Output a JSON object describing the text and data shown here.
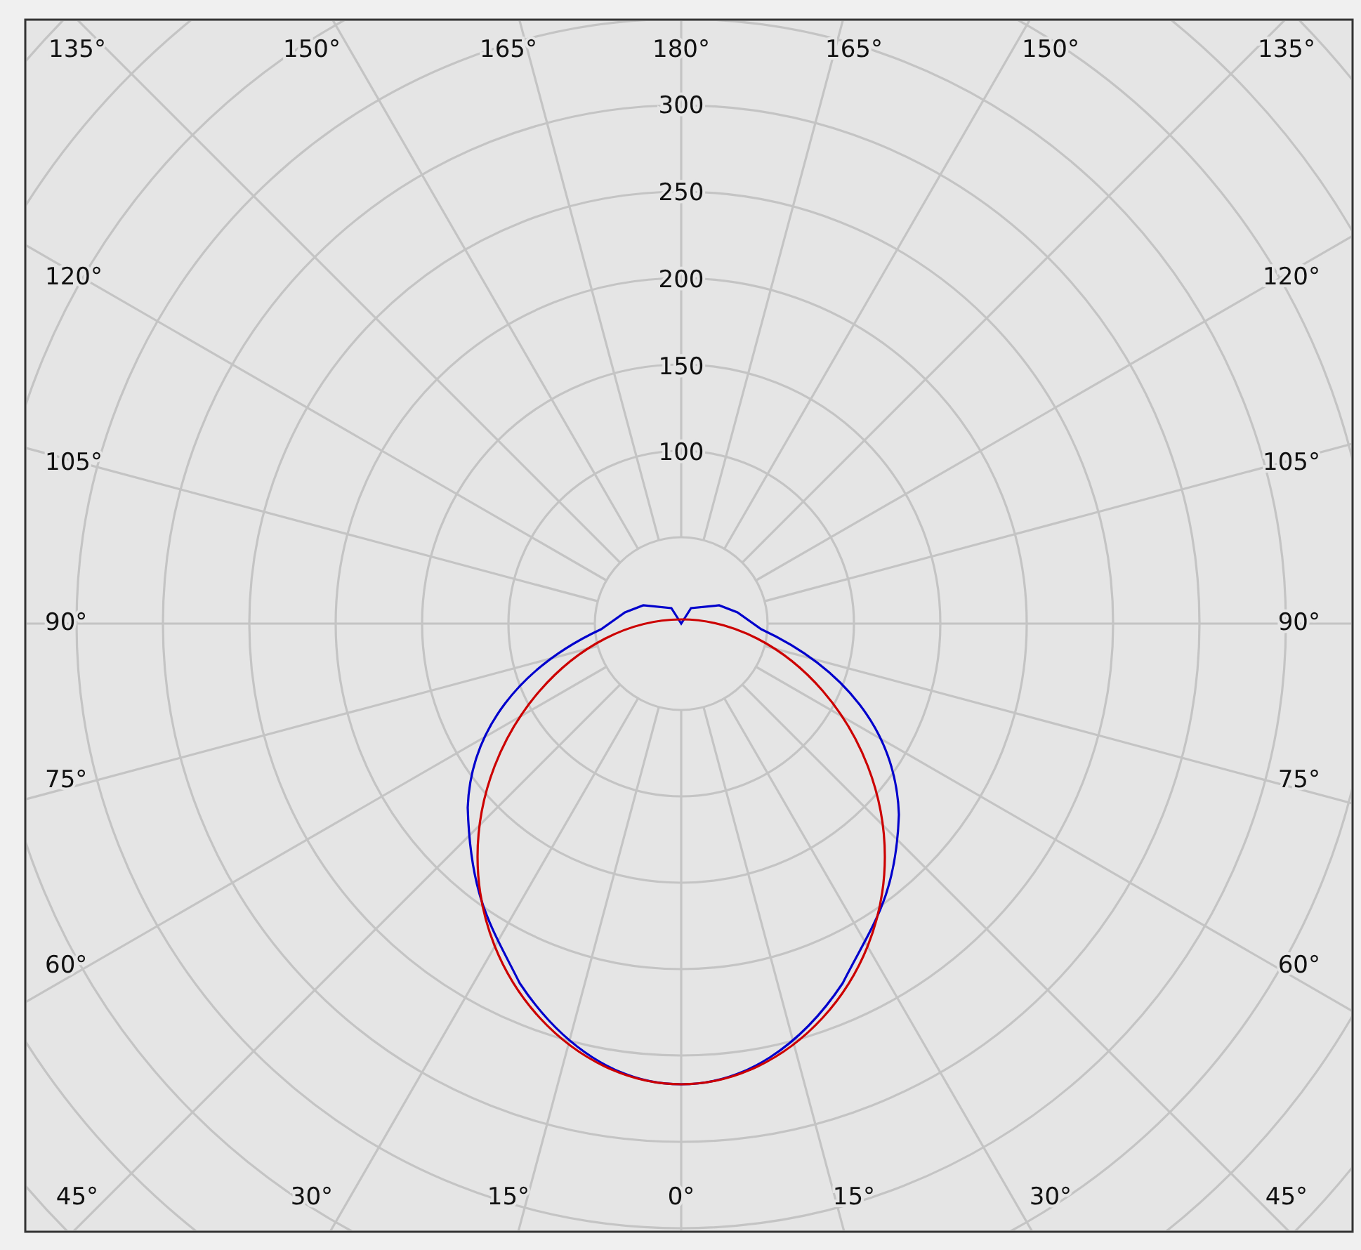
{
  "chart": {
    "top_labels": [
      "135°",
      "150°",
      "165°",
      "180°",
      "165°",
      "150°",
      "135°"
    ],
    "left_labels": [
      "120°",
      "105°",
      "90°",
      "75°",
      "60°"
    ],
    "right_labels": [
      "120°",
      "105°",
      "90°",
      "75°",
      "60°"
    ],
    "bottom_labels": [
      "45°",
      "30°",
      "15°",
      "0°",
      "15°",
      "30°",
      "45°"
    ],
    "radial_labels": [
      "300",
      "250",
      "200",
      "150",
      "100"
    ],
    "curves": [
      {
        "color": "#0000cc"
      },
      {
        "color": "#cc0000"
      }
    ]
  }
}
